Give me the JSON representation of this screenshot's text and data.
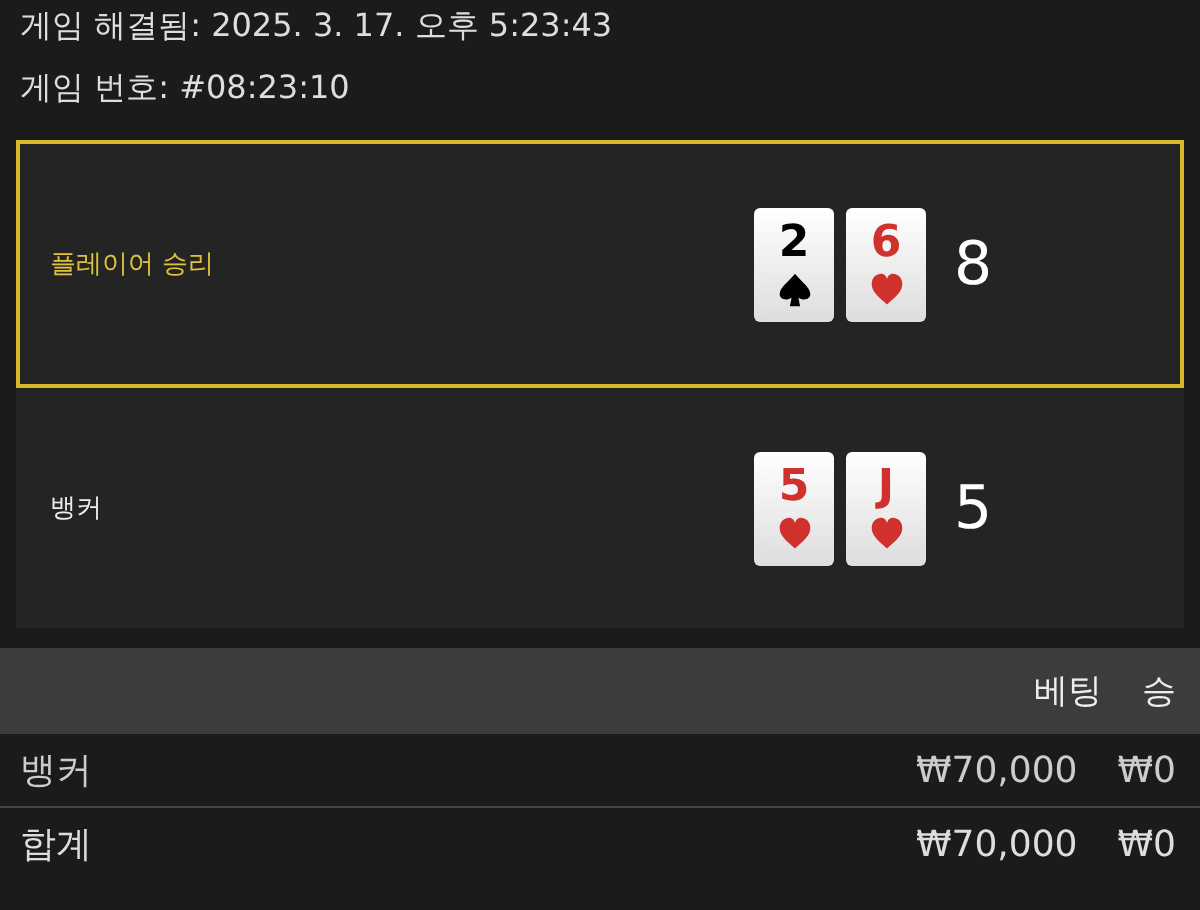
{
  "header": {
    "resolved": "게임 해결됨: 2025. 3. 17. 오후 5:23:43",
    "game_number": "게임 번호: #08:23:10"
  },
  "hands": [
    {
      "label": "플레이어 승리",
      "winner": true,
      "score": "8",
      "cards": [
        {
          "rank": "2",
          "kind": "spade"
        },
        {
          "rank": "6",
          "kind": "heart"
        }
      ]
    },
    {
      "label": "뱅커",
      "winner": false,
      "score": "5",
      "cards": [
        {
          "rank": "5",
          "kind": "heart"
        },
        {
          "rank": "J",
          "kind": "heart"
        }
      ]
    }
  ],
  "table": {
    "columns": [
      "베팅",
      "승"
    ],
    "rows": [
      {
        "label": "뱅커",
        "bet": "₩70,000",
        "win": "₩0"
      },
      {
        "label": "합계",
        "bet": "₩70,000",
        "win": "₩0"
      }
    ]
  }
}
